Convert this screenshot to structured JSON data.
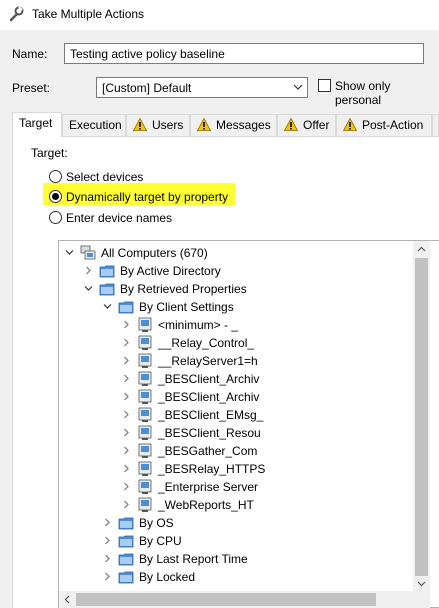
{
  "window": {
    "title": "Take Multiple Actions"
  },
  "form": {
    "name_label": "Name:",
    "name_value": "Testing active policy baseline",
    "preset_label": "Preset:",
    "preset_value": "[Custom] Default",
    "show_only_personal_label": "Show only personal",
    "show_only_personal_checked": false
  },
  "tabs": [
    {
      "label": "Target",
      "active": true,
      "warning": false
    },
    {
      "label": "Execution",
      "active": false,
      "warning": false
    },
    {
      "label": "Users",
      "active": false,
      "warning": true
    },
    {
      "label": "Messages",
      "active": false,
      "warning": true
    },
    {
      "label": "Offer",
      "active": false,
      "warning": true
    },
    {
      "label": "Post-Action",
      "active": false,
      "warning": true
    }
  ],
  "target": {
    "heading": "Target:",
    "options": [
      {
        "label": "Select devices",
        "selected": false
      },
      {
        "label": "Dynamically target by property",
        "selected": true,
        "highlight": "#ffff33"
      },
      {
        "label": "Enter device names",
        "selected": false
      }
    ]
  },
  "tree": {
    "root": "All Computers (670)",
    "items": [
      "By Active Directory",
      "By Retrieved Properties",
      "By Client Settings",
      "<minimum> - _",
      "__Relay_Control_",
      "__RelayServer1=h",
      "_BESClient_Archiv",
      "_BESClient_Archiv",
      "_BESClient_EMsg_",
      "_BESClient_Resou",
      "_BESGather_Com",
      "_BESRelay_HTTPS",
      "_Enterprise Server",
      "_WebReports_HT",
      "By OS",
      "By CPU",
      "By Last Report Time",
      "By Locked"
    ]
  },
  "colors": {
    "highlight": "#ffff33",
    "folder": "#4d8fd6",
    "warning": "#f5c400"
  }
}
